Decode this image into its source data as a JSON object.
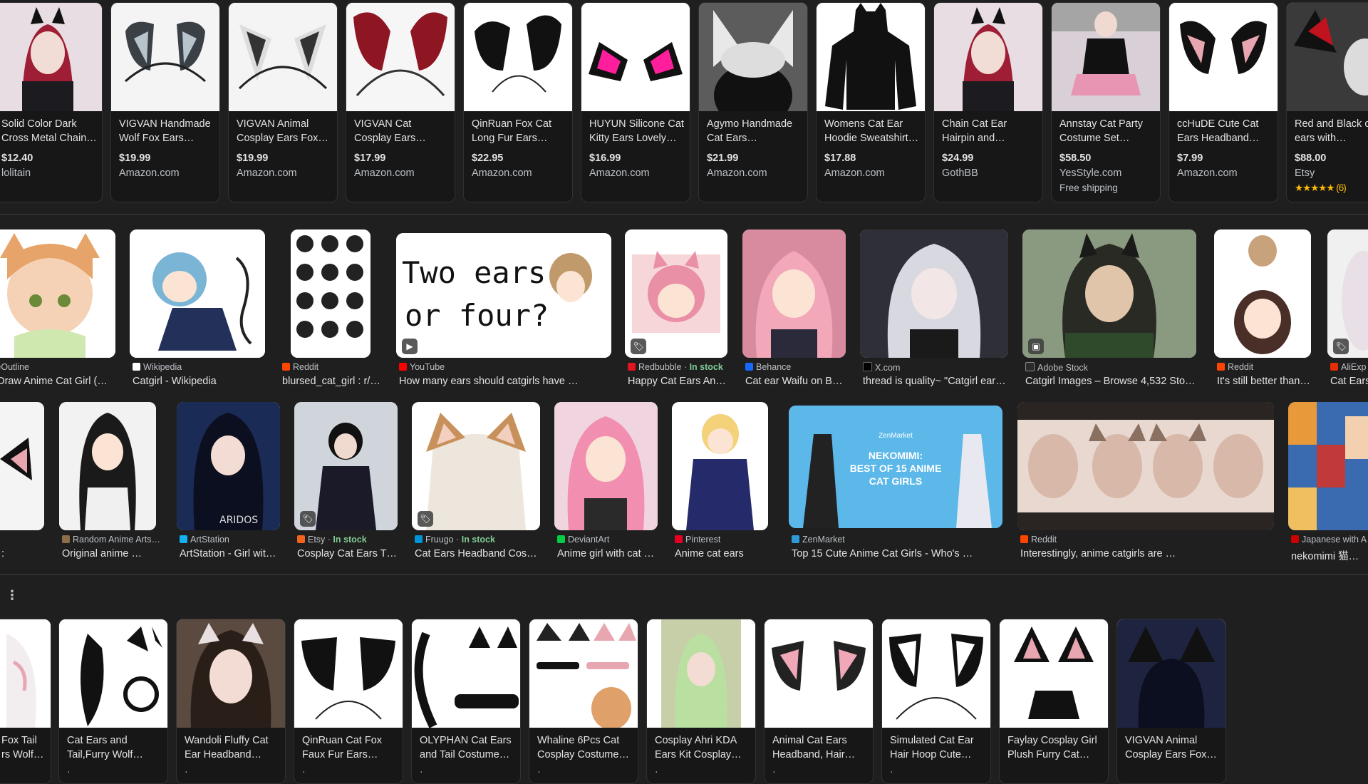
{
  "products_row": [
    {
      "title": "Solid Color Dark Cross Metal Chain…",
      "price": "$12.40",
      "store": "lolitain",
      "extra": "",
      "thumb_bg": "#b03a4a"
    },
    {
      "title": "VIGVAN Handmade Wolf Fox Ears…",
      "price": "$19.99",
      "store": "Amazon.com",
      "extra": "",
      "thumb_bg": "#f4f4f4"
    },
    {
      "title": "VIGVAN Animal Cosplay Ears Fox…",
      "price": "$19.99",
      "store": "Amazon.com",
      "extra": "",
      "thumb_bg": "#f4f4f4"
    },
    {
      "title": "VIGVAN Cat Cosplay Ears…",
      "price": "$17.99",
      "store": "Amazon.com",
      "extra": "",
      "thumb_bg": "#f6f6f6"
    },
    {
      "title": "QinRuan Fox Cat Long Fur Ears Hair…",
      "price": "$22.95",
      "store": "Amazon.com",
      "extra": "",
      "thumb_bg": "#ffffff"
    },
    {
      "title": "HUYUN Silicone Cat Kitty Ears Lovely…",
      "price": "$16.99",
      "store": "Amazon.com",
      "extra": "",
      "thumb_bg": "#ffffff"
    },
    {
      "title": "Agymo Handmade Cat Ears…",
      "price": "$21.99",
      "store": "Amazon.com",
      "extra": "",
      "thumb_bg": "#5c5c5c"
    },
    {
      "title": "Womens Cat Ear Hoodie Sweatshirt…",
      "price": "$17.88",
      "store": "Amazon.com",
      "extra": "",
      "thumb_bg": "#ffffff"
    },
    {
      "title": "Chain Cat Ear Hairpin and…",
      "price": "$24.99",
      "store": "GothBB",
      "extra": "",
      "thumb_bg": "#b03a4a"
    },
    {
      "title": "Annstay Cat Party Costume Set…",
      "price": "$58.50",
      "store": "YesStyle.com",
      "extra": "Free shipping",
      "thumb_bg": "#d9c6d2"
    },
    {
      "title": "ccHuDE Cute Cat Ears Headband Fo…",
      "price": "$7.99",
      "store": "Amazon.com",
      "extra": "",
      "thumb_bg": "#ffffff"
    },
    {
      "title": "Red and Black cat ears with…",
      "price": "$88.00",
      "store": "Etsy",
      "extra": "★★★★★ (6)",
      "thumb_bg": "#3a3a3a"
    }
  ],
  "images_row1": [
    {
      "source": "meOutline",
      "stock": "",
      "caption": "o Draw Anime Cat Girl (…",
      "fav": "#e8e8e8",
      "bg": "#f7e7d6",
      "badge": ""
    },
    {
      "source": "Wikipedia",
      "stock": "",
      "caption": "Catgirl - Wikipedia",
      "fav": "#ffffff",
      "bg": "#ffffff",
      "badge": ""
    },
    {
      "source": "Reddit",
      "stock": "",
      "caption": "blursed_cat_girl : r/…",
      "fav": "#ff4500",
      "bg": "#ffffff",
      "badge": ""
    },
    {
      "source": "YouTube",
      "stock": "",
      "caption": "How many ears should catgirls have …",
      "fav": "#ff0000",
      "bg": "#ffffff",
      "badge": "▶",
      "overlay": "Two ears\nor four?"
    },
    {
      "source": "Redbubble",
      "stock": "In stock",
      "caption": "Happy Cat Ears Ani…",
      "fav": "#e41321",
      "bg": "#f6d6d8",
      "badge": "🏷"
    },
    {
      "source": "Behance",
      "stock": "",
      "caption": "Cat ear Waifu on Be…",
      "fav": "#1769ff",
      "bg": "#e8a6b6",
      "badge": ""
    },
    {
      "source": "X.com",
      "stock": "",
      "caption": "thread is quality~ \"Catgirl ear…",
      "fav": "#000000",
      "bg": "#3a3a42",
      "badge": ""
    },
    {
      "source": "Adobe Stock",
      "stock": "",
      "caption": "Catgirl Images – Browse 4,532 Sto…",
      "fav": "#2b2b2b",
      "bg": "#8a9a80",
      "badge": "▣"
    },
    {
      "source": "Reddit",
      "stock": "",
      "caption": "It's still better than …",
      "fav": "#ff4500",
      "bg": "#ffffff",
      "badge": ""
    },
    {
      "source": "AliExp",
      "stock": "",
      "caption": "Cat Ears",
      "fav": "#e62e04",
      "bg": "#f0f0f0",
      "badge": "🏷"
    }
  ],
  "images_row2": [
    {
      "source": "",
      "stock": "",
      "caption": "t :",
      "fav": "",
      "bg": "#f4f4f4",
      "badge": ""
    },
    {
      "source": "Random Anime Arts…",
      "stock": "",
      "caption": "Original anime …",
      "fav": "#8b6f47",
      "bg": "#f2f2f2",
      "badge": ""
    },
    {
      "source": "ArtStation",
      "stock": "",
      "caption": "ArtStation - Girl wit…",
      "fav": "#13aff0",
      "bg": "#1a2b55",
      "badge": ""
    },
    {
      "source": "Etsy",
      "stock": "In stock",
      "caption": "Cosplay Cat Ears T…",
      "fav": "#f1641e",
      "bg": "#cfd5db",
      "badge": "🏷"
    },
    {
      "source": "Fruugo",
      "stock": "In stock",
      "caption": "Cat Ears Headband Cosp…",
      "fav": "#0094d9",
      "bg": "#ffffff",
      "badge": "🏷"
    },
    {
      "source": "DeviantArt",
      "stock": "",
      "caption": "Anime girl with cat …",
      "fav": "#05cc47",
      "bg": "#f0d5e0",
      "badge": ""
    },
    {
      "source": "Pinterest",
      "stock": "",
      "caption": "Anime cat ears",
      "fav": "#e60023",
      "bg": "#ffffff",
      "badge": ""
    },
    {
      "source": "ZenMarket",
      "stock": "",
      "caption": "Top 15 Cute Anime Cat Girls - Who's …",
      "fav": "#2e9ad6",
      "bg": "#4fb0e8",
      "badge": "",
      "overlay": "NEKOMIMI:\nBEST OF 15 ANIME\nCAT GIRLS",
      "brand": "ZenMarket"
    },
    {
      "source": "Reddit",
      "stock": "",
      "caption": "Interestingly, anime catgirls are …",
      "fav": "#ff4500",
      "bg": "#e8d8cf",
      "badge": ""
    },
    {
      "source": "Japanese with A",
      "stock": "",
      "caption": "nekomimi 猫耳 (C",
      "fav": "#cc0000",
      "bg": "#3a6ab0",
      "badge": ""
    }
  ],
  "products_row2": [
    {
      "title": "Fox Tail rs Wolf…",
      "bg": "#ffffff"
    },
    {
      "title": "Cat Ears and Tail,Furry Wolf Fox…",
      "bg": "#ffffff"
    },
    {
      "title": "Wandoli Fluffy Cat Ear Headband…",
      "bg": "#5a4a40"
    },
    {
      "title": "QinRuan Cat Fox Faux Fur Ears…",
      "bg": "#ffffff"
    },
    {
      "title": "OLYPHAN Cat Ears and Tail Costume…",
      "bg": "#ffffff"
    },
    {
      "title": "Whaline 6Pcs Cat Cosplay Costume…",
      "bg": "#ffffff"
    },
    {
      "title": "Cosplay Ahri KDA Ears Kit Cosplay…",
      "bg": "#c7cfa8"
    },
    {
      "title": "Animal Cat Ears Headband, Hair…",
      "bg": "#ffffff"
    },
    {
      "title": "Simulated Cat Ear Hair Hoop Cute…",
      "bg": "#ffffff"
    },
    {
      "title": "Faylay Cosplay Girl Plush Furry Cat…",
      "bg": "#ffffff"
    },
    {
      "title": "VIGVAN Animal Cosplay Ears Fox…",
      "bg": "#1e2440"
    }
  ],
  "more_menu_icon": "⋮",
  "colors": {
    "background": "#1f1f1f",
    "card": "#171717",
    "text": "#e3e3e3",
    "muted": "#bdc1c6",
    "in_stock": "#81c995",
    "stars": "#fbbc04"
  }
}
